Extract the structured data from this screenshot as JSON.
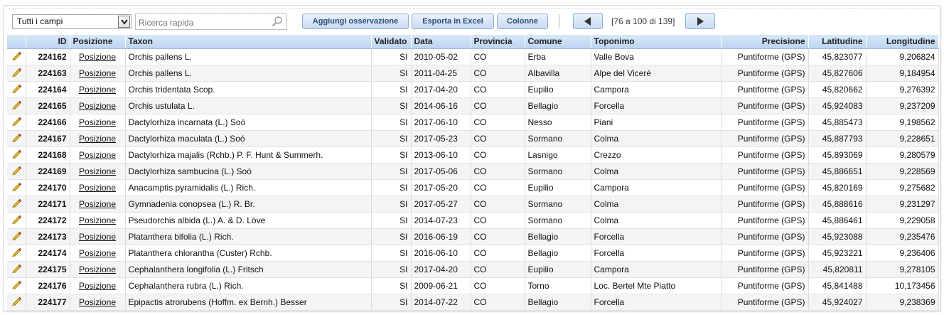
{
  "toolbar": {
    "field_select": "Tutti i campi",
    "search_placeholder": "Ricerca rapida",
    "add_label": "Aggiungi osservazione",
    "export_label": "Esporta in Excel",
    "columns_label": "Colonne",
    "range": "[76 a 100 di 139]"
  },
  "columns": [
    "",
    "ID",
    "Posizione",
    "Taxon",
    "Validato",
    "Data",
    "Provincia",
    "Comune",
    "Toponimo",
    "Precisione",
    "Latitudine",
    "Longitudine"
  ],
  "rows": [
    {
      "id": "224162",
      "pos": "Posizione",
      "taxon": "Orchis pallens L.",
      "val": "SI",
      "date": "2010-05-02",
      "prov": "CO",
      "comune": "Erba",
      "topo": "Valle Bova",
      "prec": "Puntiforme (GPS)",
      "lat": "45,823077",
      "lon": "9,206824"
    },
    {
      "id": "224163",
      "pos": "Posizione",
      "taxon": "Orchis pallens L.",
      "val": "SI",
      "date": "2011-04-25",
      "prov": "CO",
      "comune": "Albavilla",
      "topo": "Alpe del Vicerè",
      "prec": "Puntiforme (GPS)",
      "lat": "45,827606",
      "lon": "9,184954"
    },
    {
      "id": "224164",
      "pos": "Posizione",
      "taxon": "Orchis tridentata Scop.",
      "val": "SI",
      "date": "2017-04-20",
      "prov": "CO",
      "comune": "Eupilio",
      "topo": "Campora",
      "prec": "Puntiforme (GPS)",
      "lat": "45,820662",
      "lon": "9,276392"
    },
    {
      "id": "224165",
      "pos": "Posizione",
      "taxon": "Orchis ustulata L.",
      "val": "SI",
      "date": "2014-06-16",
      "prov": "CO",
      "comune": "Bellagio",
      "topo": "Forcella",
      "prec": "Puntiforme (GPS)",
      "lat": "45,924083",
      "lon": "9,237209"
    },
    {
      "id": "224166",
      "pos": "Posizione",
      "taxon": "Dactylorhiza incarnata (L.) Soó",
      "val": "SI",
      "date": "2017-06-10",
      "prov": "CO",
      "comune": "Nesso",
      "topo": "Piani",
      "prec": "Puntiforme (GPS)",
      "lat": "45,885473",
      "lon": "9,198562"
    },
    {
      "id": "224167",
      "pos": "Posizione",
      "taxon": "Dactylorhiza maculata (L.) Soó",
      "val": "SI",
      "date": "2017-05-23",
      "prov": "CO",
      "comune": "Sormano",
      "topo": "Colma",
      "prec": "Puntiforme (GPS)",
      "lat": "45,887793",
      "lon": "9,228651"
    },
    {
      "id": "224168",
      "pos": "Posizione",
      "taxon": "Dactylorhiza majalis (Rchb.) P. F. Hunt & Summerh.",
      "val": "SI",
      "date": "2013-06-10",
      "prov": "CO",
      "comune": "Lasnigo",
      "topo": "Crezzo",
      "prec": "Puntiforme (GPS)",
      "lat": "45,893069",
      "lon": "9,280579"
    },
    {
      "id": "224169",
      "pos": "Posizione",
      "taxon": "Dactylorhiza sambucina (L.) Soó",
      "val": "SI",
      "date": "2017-05-06",
      "prov": "CO",
      "comune": "Sormano",
      "topo": "Colma",
      "prec": "Puntiforme (GPS)",
      "lat": "45,886651",
      "lon": "9,228569"
    },
    {
      "id": "224170",
      "pos": "Posizione",
      "taxon": "Anacamptis pyramidalis (L.) Rich.",
      "val": "SI",
      "date": "2017-05-20",
      "prov": "CO",
      "comune": "Eupilio",
      "topo": "Campora",
      "prec": "Puntiforme (GPS)",
      "lat": "45,820169",
      "lon": "9,275682"
    },
    {
      "id": "224171",
      "pos": "Posizione",
      "taxon": "Gymnadenia conopsea (L.) R. Br.",
      "val": "SI",
      "date": "2017-05-27",
      "prov": "CO",
      "comune": "Sormano",
      "topo": "Colma",
      "prec": "Puntiforme (GPS)",
      "lat": "45,888616",
      "lon": "9,231297"
    },
    {
      "id": "224172",
      "pos": "Posizione",
      "taxon": "Pseudorchis albida (L.) A. & D. Löve",
      "val": "SI",
      "date": "2014-07-23",
      "prov": "CO",
      "comune": "Sormano",
      "topo": "Colma",
      "prec": "Puntiforme (GPS)",
      "lat": "45,886461",
      "lon": "9,229058"
    },
    {
      "id": "224173",
      "pos": "Posizione",
      "taxon": "Platanthera bifolia (L.) Rich.",
      "val": "SI",
      "date": "2016-06-19",
      "prov": "CO",
      "comune": "Bellagio",
      "topo": "Forcella",
      "prec": "Puntiforme (GPS)",
      "lat": "45,923088",
      "lon": "9,235476"
    },
    {
      "id": "224174",
      "pos": "Posizione",
      "taxon": "Platanthera chlorantha (Custer) Rchb.",
      "val": "SI",
      "date": "2016-06-10",
      "prov": "CO",
      "comune": "Bellagio",
      "topo": "Forcella",
      "prec": "Puntiforme (GPS)",
      "lat": "45,923221",
      "lon": "9,236406"
    },
    {
      "id": "224175",
      "pos": "Posizione",
      "taxon": "Cephalanthera longifolia (L.) Fritsch",
      "val": "SI",
      "date": "2017-04-20",
      "prov": "CO",
      "comune": "Eupilio",
      "topo": "Campora",
      "prec": "Puntiforme (GPS)",
      "lat": "45,820811",
      "lon": "9,278105"
    },
    {
      "id": "224176",
      "pos": "Posizione",
      "taxon": "Cephalanthera rubra (L.) Rich.",
      "val": "SI",
      "date": "2009-06-21",
      "prov": "CO",
      "comune": "Torno",
      "topo": "Loc. Bertel Mte Piatto",
      "prec": "Puntiforme (GPS)",
      "lat": "45,841488",
      "lon": "10,173456"
    },
    {
      "id": "224177",
      "pos": "Posizione",
      "taxon": "Epipactis atrorubens (Hoffm. ex Bernh.) Besser",
      "val": "SI",
      "date": "2014-07-22",
      "prov": "CO",
      "comune": "Bellagio",
      "topo": "Forcella",
      "prec": "Puntiforme (GPS)",
      "lat": "45,924027",
      "lon": "9,238369"
    }
  ]
}
